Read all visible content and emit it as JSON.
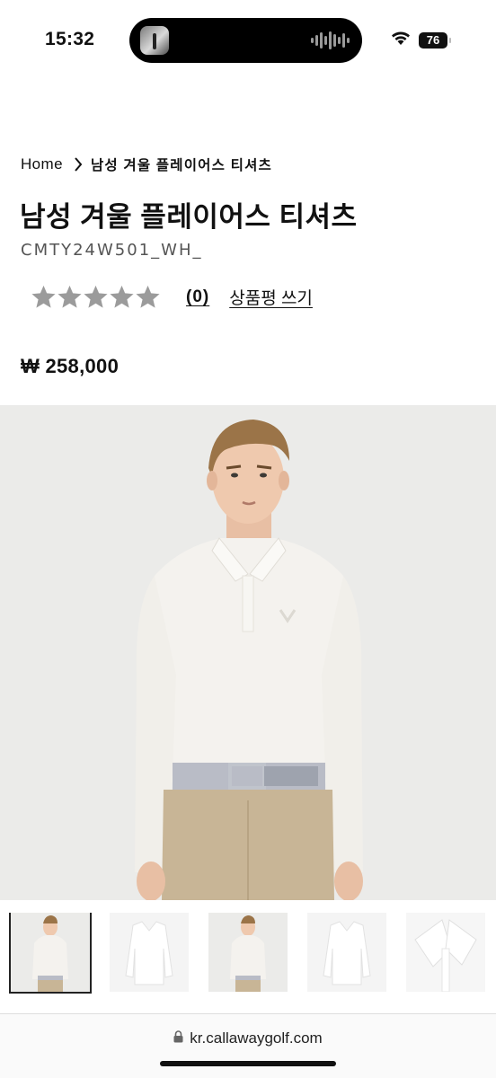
{
  "status_bar": {
    "time": "15:32",
    "battery": "76",
    "icons": [
      "now-playing-thumbnail-icon",
      "audio-waveform-icon",
      "wifi-icon",
      "battery-icon"
    ]
  },
  "breadcrumb": {
    "home": "Home",
    "current": "남성 겨울 플레이어스 티셔츠"
  },
  "product": {
    "title": "남성 겨울 플레이어스 티셔츠",
    "code": "CMTY24W501_WH_",
    "rating": 0,
    "rating_max": 5,
    "review_count": "(0)",
    "write_review": "상품평 쓰기",
    "price": "₩ 258,000"
  },
  "gallery": {
    "selected_index": 0,
    "thumbnails": [
      "model-front",
      "product-front",
      "model-front",
      "product-front",
      "collar-detail"
    ]
  },
  "browser": {
    "url": "kr.callawaygolf.com"
  },
  "colors": {
    "text": "#111111",
    "star_empty": "#9b9b9b",
    "image_bg": "#ebebe9",
    "shirt": "#f4f2ee",
    "pants": "#c8b596"
  }
}
